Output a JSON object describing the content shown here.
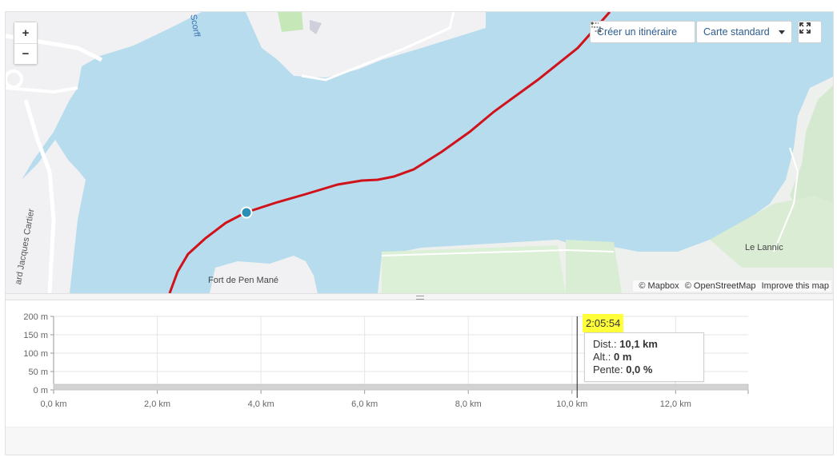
{
  "map": {
    "zoom_in": "+",
    "zoom_out": "−",
    "route_button_label": "Créer un itinéraire",
    "layer_select_value": "Carte standard",
    "fullscreen_icon": "expand-icon",
    "attribution": {
      "mapbox": "© Mapbox",
      "osm": "© OpenStreetMap",
      "improve": "Improve this map"
    },
    "labels": {
      "scorff": "Scorff",
      "street": "ard Jacques Cartier",
      "fort": "Fort de Pen Mané",
      "lannic": "Le Lannic"
    },
    "colors": {
      "water": "#b7dced",
      "land": "#f2f2f4",
      "green": "#d9ebd5",
      "route": "#d0121b",
      "marker": "#2a8fb5"
    }
  },
  "profile": {
    "chart_data": {
      "type": "area",
      "xlabel": "",
      "ylabel": "",
      "x_ticks": [
        "0,0 km",
        "2,0 km",
        "4,0 km",
        "6,0 km",
        "8,0 km",
        "10,0 km",
        "12,0 km"
      ],
      "y_ticks": [
        "200 m",
        "150 m",
        "100 m",
        "50 m",
        "0 m"
      ],
      "xlim_km": [
        0,
        13.4
      ],
      "ylim_m": [
        0,
        200
      ],
      "series": [
        {
          "x_km": [
            0,
            1,
            2,
            4,
            6,
            8,
            10,
            12,
            13.4
          ],
          "y_m": [
            2,
            2,
            2,
            2,
            2,
            2,
            2,
            2,
            2
          ]
        }
      ],
      "cursor_km": 10.1
    },
    "cursor": {
      "time": "2:05:54",
      "dist_label": "Dist.:",
      "dist_value": "10,1 km",
      "alt_label": "Alt.:",
      "alt_value": "0 m",
      "slope_label": "Pente:",
      "slope_value": "0,0 %"
    }
  }
}
